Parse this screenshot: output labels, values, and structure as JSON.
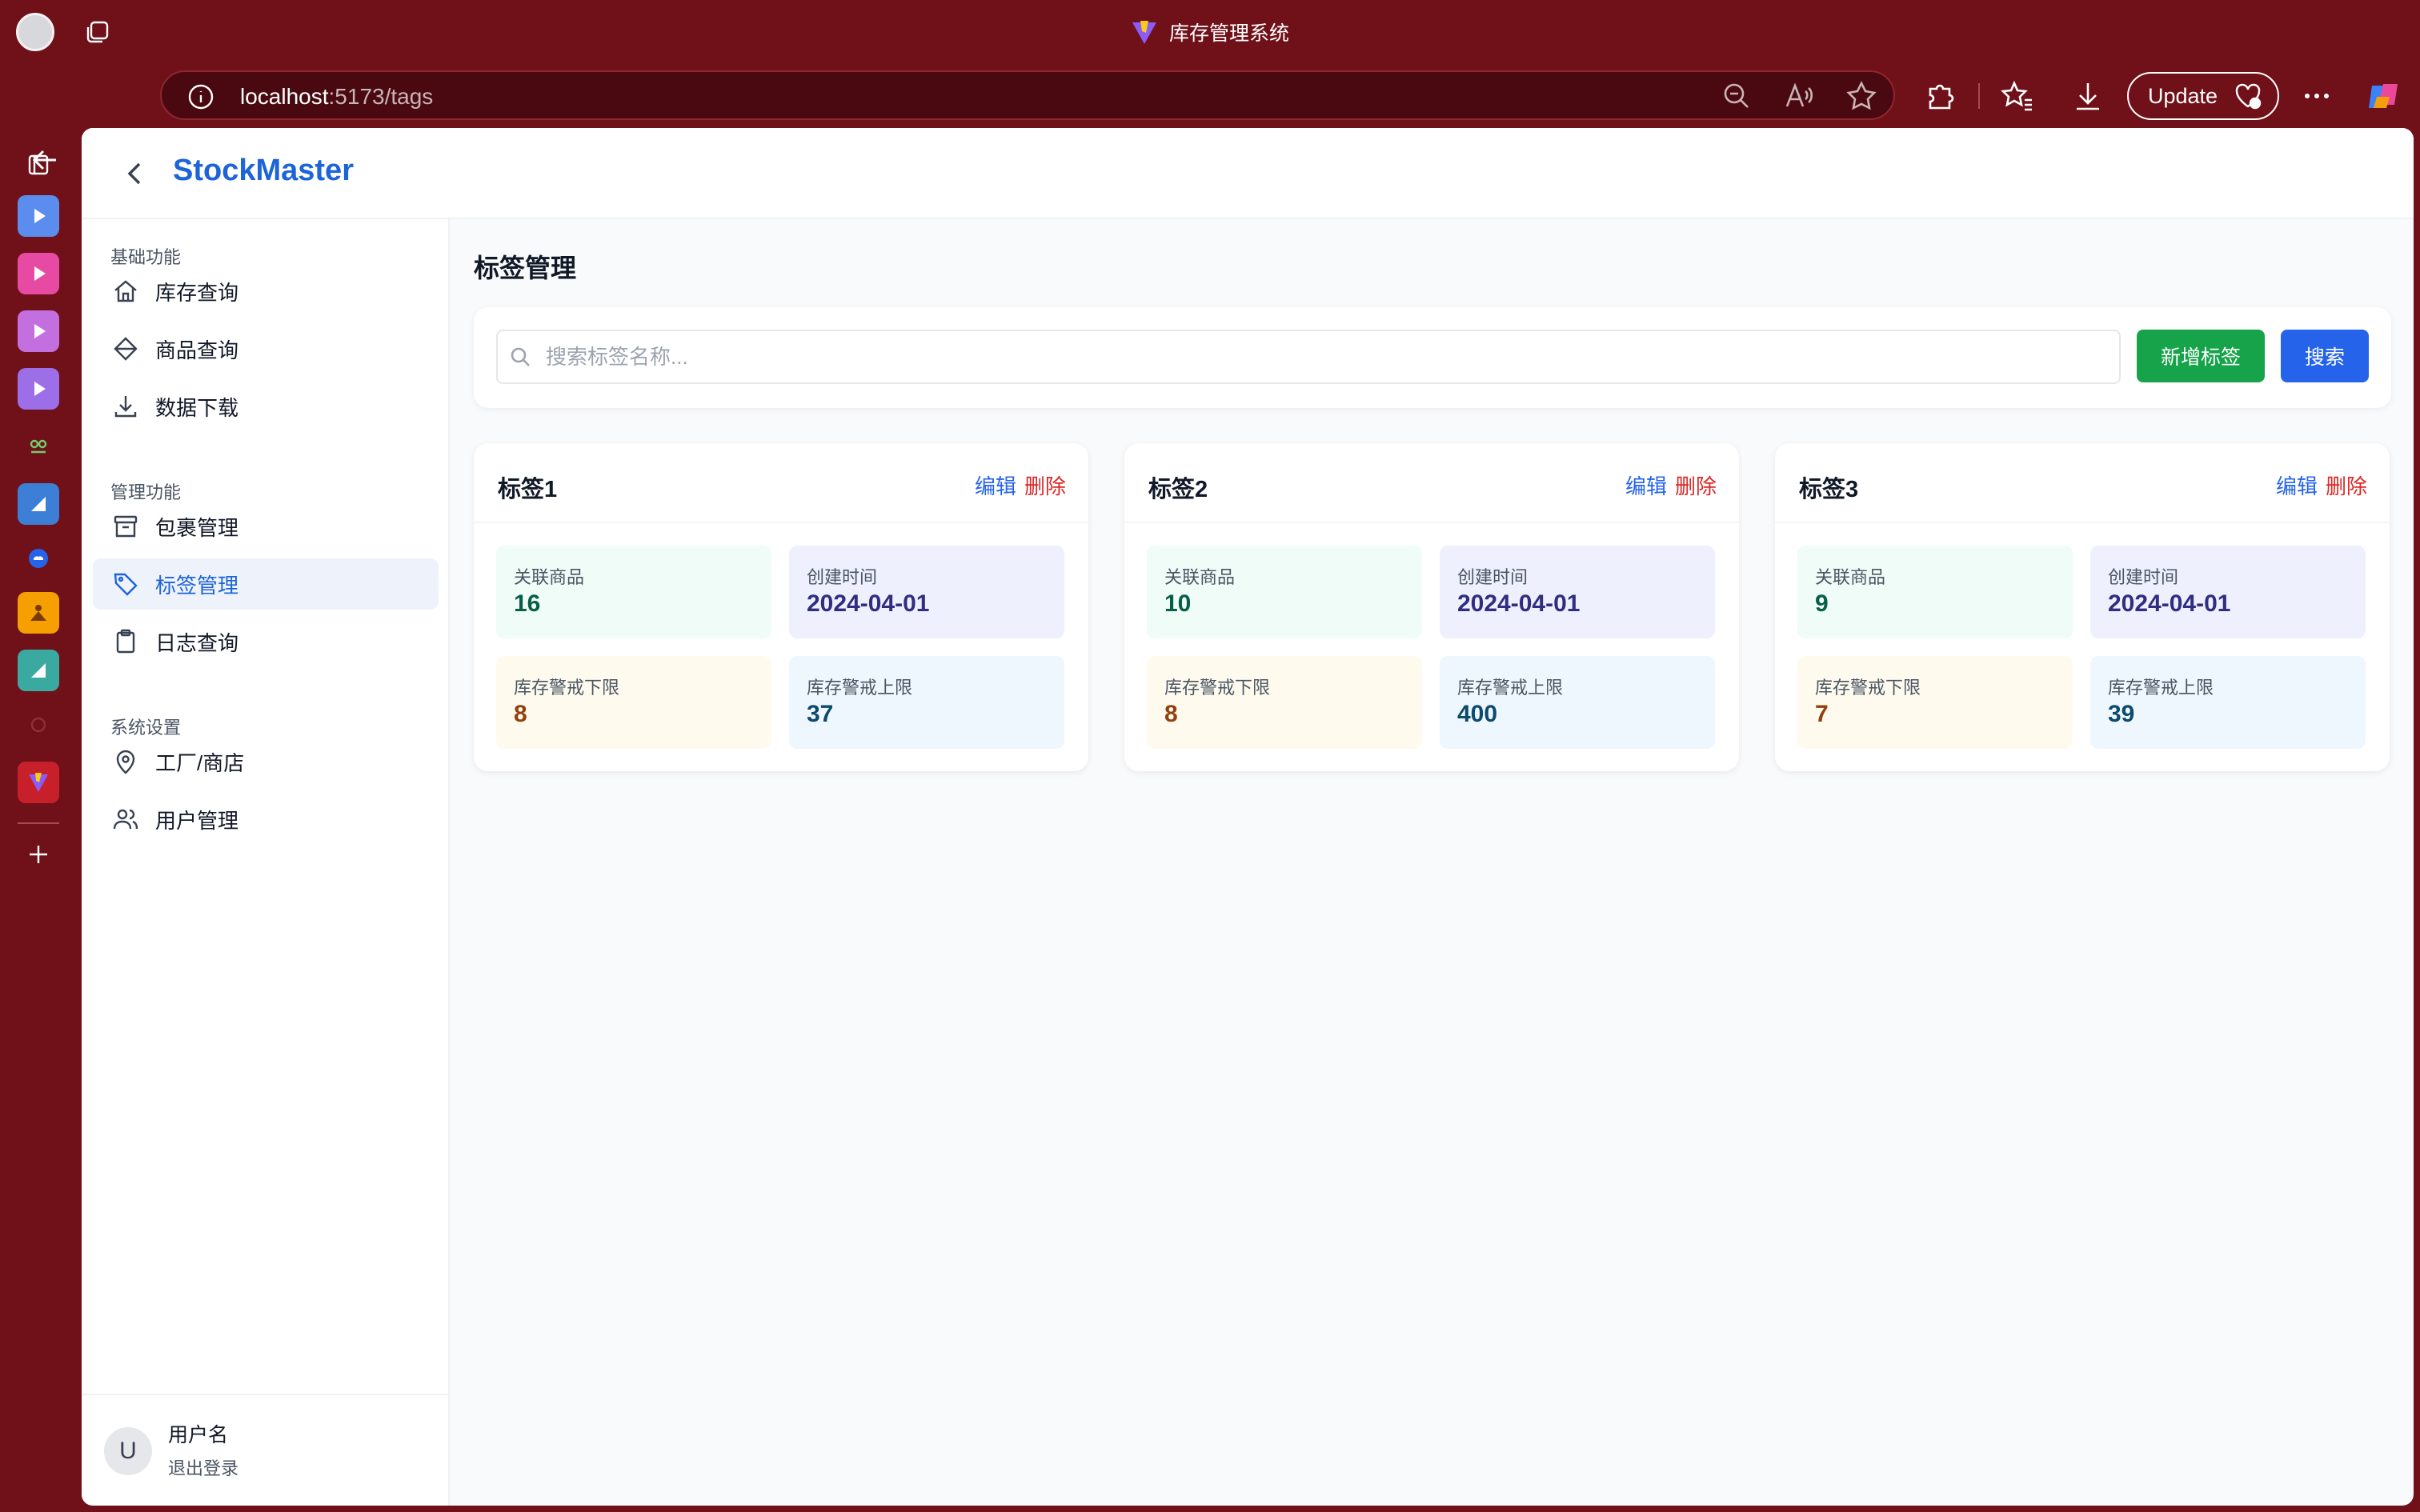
{
  "browser": {
    "tab_title": "库存管理系统",
    "url_host": "localhost",
    "url_path": ":5173/tags",
    "update_label": "Update"
  },
  "app": {
    "brand": "StockMaster",
    "page_title": "标签管理",
    "nav": {
      "section_basic": "基础功能",
      "inventory_query": "库存查询",
      "product_query": "商品查询",
      "data_download": "数据下载",
      "section_manage": "管理功能",
      "package_manage": "包裹管理",
      "tag_manage": "标签管理",
      "log_query": "日志查询",
      "section_settings": "系统设置",
      "factory_store": "工厂/商店",
      "user_manage": "用户管理"
    },
    "user": {
      "avatar_letter": "U",
      "name": "用户名",
      "logout": "退出登录"
    },
    "search": {
      "placeholder": "搜索标签名称...",
      "add_label": "新增标签",
      "search_label": "搜索"
    },
    "labels": {
      "edit": "编辑",
      "delete": "删除",
      "linked_products": "关联商品",
      "created_time": "创建时间",
      "stock_lower": "库存警戒下限",
      "stock_upper": "库存警戒上限"
    },
    "tags": [
      {
        "name": "标签1",
        "linked": "16",
        "created": "2024-04-01",
        "lower": "8",
        "upper": "37"
      },
      {
        "name": "标签2",
        "linked": "10",
        "created": "2024-04-01",
        "lower": "8",
        "upper": "400"
      },
      {
        "name": "标签3",
        "linked": "9",
        "created": "2024-04-01",
        "lower": "7",
        "upper": "39"
      }
    ]
  },
  "colors": {
    "browser_frame": "#701019",
    "brand_blue": "#1d64d8",
    "add_green": "#16a34a",
    "search_blue": "#2563eb",
    "delete_red": "#dc2626"
  }
}
